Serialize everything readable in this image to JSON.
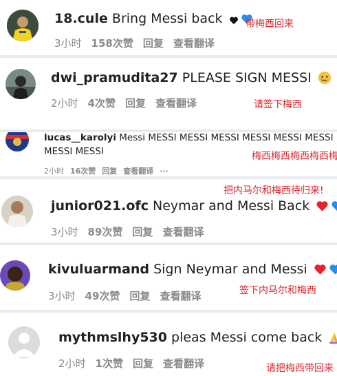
{
  "comments": [
    {
      "username": "18.cule",
      "text": "Bring Messi back",
      "time": "3小时",
      "likes": "158次赞",
      "reply": "回复",
      "translate": "查看翻译",
      "translation": "带梅西回来",
      "emojis": [
        "black-heart",
        "blue-heart"
      ]
    },
    {
      "username": "dwi_pramudita27",
      "text": "PLEASE SIGN MESSI",
      "time": "2小时",
      "likes": "4次赞",
      "reply": "回复",
      "translate": "查看翻译",
      "translation": "请签下梅西",
      "emojis": [
        "crying-face"
      ]
    },
    {
      "username": "lucas__karolyi",
      "text_line1": "Messi MESSI MESSI MESSI MESSI MESSI MESSI",
      "text_line2": "MESSI MESSI",
      "time": "2小时",
      "likes": "16次赞",
      "reply": "回复",
      "translate": "查看翻译",
      "more": "···",
      "translation": "梅西梅西梅西梅西梅西"
    },
    {
      "username": "junior021.ofc",
      "text": "Neymar and Messi Back",
      "time": "3小时",
      "likes": "89次赞",
      "reply": "回复",
      "translate": "查看翻译",
      "translation": "把内马尔和梅西待归来!",
      "emojis": [
        "red-heart",
        "blue-heart"
      ]
    },
    {
      "username": "kivuluarmand",
      "text": "Sign Neymar and Messi",
      "time": "3小时",
      "likes": "49次赞",
      "reply": "回复",
      "translate": "查看翻译",
      "translation": "签下内马尔和梅西",
      "emojis": [
        "red-heart",
        "blue-heart"
      ]
    },
    {
      "username": "mythmslhy530",
      "text": "pleas Messi come back",
      "time": "2小时",
      "likes": "1次赞",
      "reply": "回复",
      "translate": "查看翻译",
      "translation": "请把梅西带回来",
      "emojis": [
        "folded-hands"
      ]
    }
  ],
  "colors": {
    "translation": "#e0242b",
    "meta": "#8a8a8a",
    "separator": "#e8ecf2",
    "blue_heart": "#2b8cf0",
    "red_heart": "#e8212e"
  }
}
